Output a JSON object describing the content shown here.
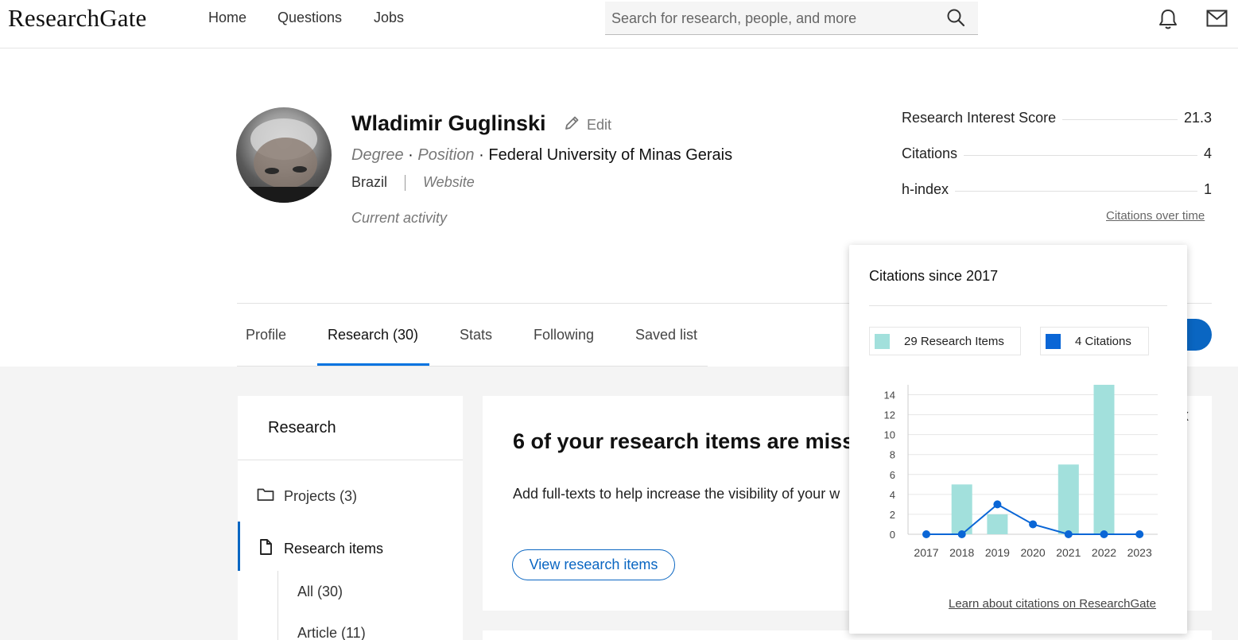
{
  "header": {
    "logo": "ResearchGate",
    "nav": [
      "Home",
      "Questions",
      "Jobs"
    ],
    "search_placeholder": "Search for research, people, and more"
  },
  "icons": {
    "search": "search-icon",
    "notifications": "bell-icon",
    "messages": "mail-icon",
    "edit": "pencil-icon",
    "folder": "folder-icon",
    "document": "document-icon"
  },
  "profile": {
    "name": "Wladimir Guglinski",
    "edit_label": "Edit",
    "degree": "Degree",
    "position": "Position",
    "dot": "·",
    "institution": "Federal University of Minas Gerais",
    "country": "Brazil",
    "website": "Website",
    "current_activity": "Current activity"
  },
  "stats": {
    "rows": [
      {
        "label": "Research Interest Score",
        "value": "21.3"
      },
      {
        "label": "Citations",
        "value": "4"
      },
      {
        "label": "h-index",
        "value": "1"
      }
    ],
    "citations_link": "Citations over time"
  },
  "tabs": [
    {
      "label": "Profile",
      "active": false
    },
    {
      "label": "Research (30)",
      "active": true
    },
    {
      "label": "Stats",
      "active": false
    },
    {
      "label": "Following",
      "active": false
    },
    {
      "label": "Saved list",
      "active": false
    }
  ],
  "action_button_visible": "h",
  "sidebar": {
    "title": "Research",
    "items": [
      {
        "label": "Projects (3)"
      },
      {
        "label": "Research items"
      }
    ],
    "subitems": [
      "All (30)",
      "Article (11)"
    ]
  },
  "card": {
    "title": "6 of your research items are miss",
    "text": "Add full-texts to help increase the visibility of your w",
    "button": "View research items",
    "close": "x"
  },
  "popover": {
    "title": "Citations since 2017",
    "legend": [
      {
        "label": "29 Research Items",
        "color": "#a2e0dc"
      },
      {
        "label": "4 Citations",
        "color": "#0a66d6"
      }
    ],
    "footer_link": "Learn about citations on ResearchGate"
  },
  "colors": {
    "accent": "#0a66c2",
    "bar": "#a2e0dc",
    "line": "#0a66d6"
  },
  "chart_data": {
    "type": "bar",
    "categories": [
      "2017",
      "2018",
      "2019",
      "2020",
      "2021",
      "2022",
      "2023"
    ],
    "series": [
      {
        "name": "29 Research Items",
        "type": "bar",
        "values": [
          0,
          5,
          2,
          0,
          7,
          15,
          0
        ]
      },
      {
        "name": "4 Citations",
        "type": "line",
        "values": [
          0,
          0,
          3,
          1,
          0,
          0,
          0
        ]
      }
    ],
    "yticks": [
      0,
      2,
      4,
      6,
      8,
      10,
      12,
      14
    ],
    "ylim": [
      0,
      15
    ],
    "grid": true,
    "legend": "top"
  }
}
